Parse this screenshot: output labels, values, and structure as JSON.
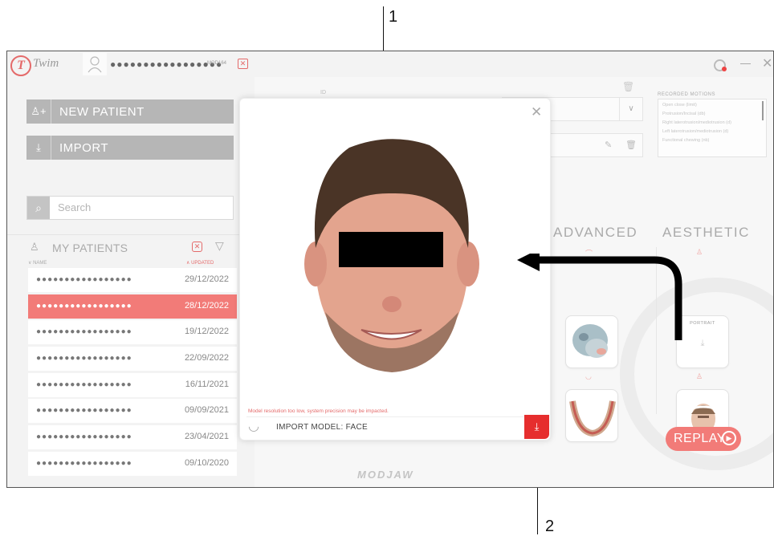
{
  "callouts": {
    "top": "1",
    "bottom": "2"
  },
  "app": {
    "title": "Twim",
    "masked_user": "●●●●●●●●●●●●●●●●●",
    "user_code": "MOD164"
  },
  "sidebar": {
    "new_patient_label": "NEW PATIENT",
    "import_label": "IMPORT",
    "search_placeholder": "Search",
    "my_patients_label": "MY PATIENTS",
    "col_name": "NAME",
    "col_updated": "UPDATED",
    "patients": [
      {
        "name": "●●●●●●●●●●●●●●●●●",
        "date": "29/12/2022",
        "selected": false
      },
      {
        "name": "●●●●●●●●●●●●●●●●●",
        "date": "28/12/2022",
        "selected": true
      },
      {
        "name": "●●●●●●●●●●●●●●●●●",
        "date": "19/12/2022",
        "selected": false
      },
      {
        "name": "●●●●●●●●●●●●●●●●●",
        "date": "22/09/2022",
        "selected": false
      },
      {
        "name": "●●●●●●●●●●●●●●●●●",
        "date": "16/11/2021",
        "selected": false
      },
      {
        "name": "●●●●●●●●●●●●●●●●●",
        "date": "09/09/2021",
        "selected": false
      },
      {
        "name": "●●●●●●●●●●●●●●●●●",
        "date": "23/04/2021",
        "selected": false
      },
      {
        "name": "●●●●●●●●●●●●●●●●●",
        "date": "09/10/2020",
        "selected": false
      }
    ]
  },
  "main": {
    "id_label": "ID",
    "recorded_motions_label": "RECORDED MOTIONS",
    "recorded_motions": [
      "Open close (limit)",
      "Protrusion/Incisal (db)",
      "Right laterotrusion/mediotrusion (d)",
      "Left laterotrusion/mediotrusion (d)",
      "Functional chewing (nb)"
    ],
    "advanced_label": "ADVANCED",
    "aesthetic_label": "AESTHETIC",
    "portrait_label": "PORTRAIT",
    "replay_label": "REPLAY",
    "footer_brand": "MODJAW"
  },
  "dialog": {
    "warning": "Model resolution too low, system precision may be impacted.",
    "import_label": "IMPORT MODEL: FACE"
  },
  "colors": {
    "accent": "#f27b78",
    "download": "#e62e2e",
    "button_gray": "#b6b6b6"
  },
  "icons": [
    "twim-logo-icon",
    "user-icon",
    "close-badge-icon",
    "record-icon",
    "minimize-icon",
    "close-icon",
    "add-user-icon",
    "import-icon",
    "search-icon",
    "filter-icon",
    "chevron-down-icon",
    "trash-icon",
    "edit-icon",
    "jaw-icon",
    "download-icon",
    "play-icon"
  ]
}
